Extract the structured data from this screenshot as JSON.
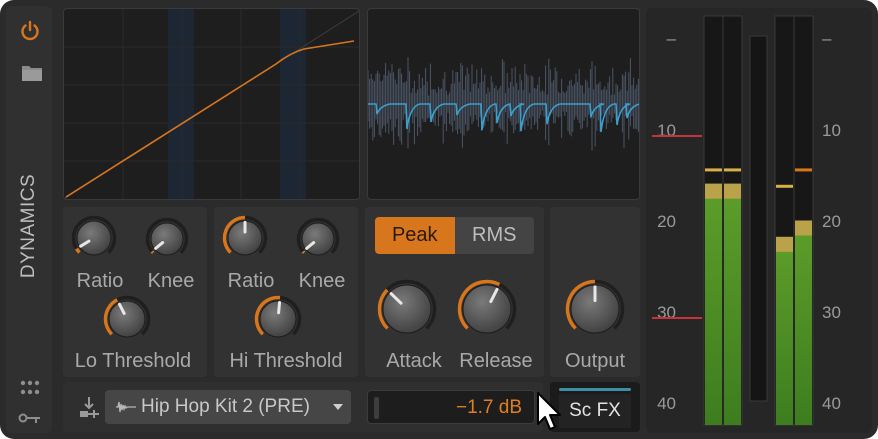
{
  "device": {
    "name": "DYNAMICS"
  },
  "icons": {
    "power": "power-icon",
    "folder": "folder-icon",
    "grid": "grid-dots-icon",
    "route": "routing-icon",
    "sidechain": "sidechain-input-icon",
    "waveform": "waveform-icon",
    "caret": "dropdown-caret-icon",
    "cursor": "mouse-pointer-icon"
  },
  "colors": {
    "accent": "#d8761e",
    "value_text": "#e07e24",
    "curve": "#d8761e",
    "wave": "#3a9fcf",
    "meter_green": "#5d9e2a",
    "meter_yellow": "#b9a24a",
    "meter_red": "#c5343a"
  },
  "lo_section": {
    "ratio_label": "Ratio",
    "knee_label": "Knee",
    "threshold_label": "Lo Threshold",
    "ratio_value": 0.05,
    "knee_value": 0.02,
    "threshold_value": 0.4
  },
  "hi_section": {
    "ratio_label": "Ratio",
    "knee_label": "Knee",
    "threshold_label": "Hi Threshold",
    "ratio_value": 0.5,
    "knee_value": 0.02,
    "threshold_value": 0.52
  },
  "timing": {
    "detection_options": [
      "Peak",
      "RMS"
    ],
    "detection_selected": "Peak",
    "attack_label": "Attack",
    "release_label": "Release",
    "attack_value": 0.33,
    "release_value": 0.6
  },
  "output": {
    "label": "Output",
    "value": 0.5
  },
  "sidechain": {
    "source": "Hip Hop Kit 2 (PRE)",
    "gain": "−1.7 dB",
    "fx_button": "Sc FX"
  },
  "meters": {
    "scale_left": [
      "–",
      "10",
      "20",
      "30",
      "40"
    ],
    "scale_right": [
      "–",
      "10",
      "20",
      "30",
      "40"
    ],
    "input_left_level": 0.59,
    "input_right_level": 0.59,
    "input_peak": 0.62,
    "output_left_level": 0.46,
    "output_right_level": 0.5,
    "output_left_peak": 0.58,
    "output_right_peak": 0.62,
    "gain_reduction_level": 0.0
  }
}
